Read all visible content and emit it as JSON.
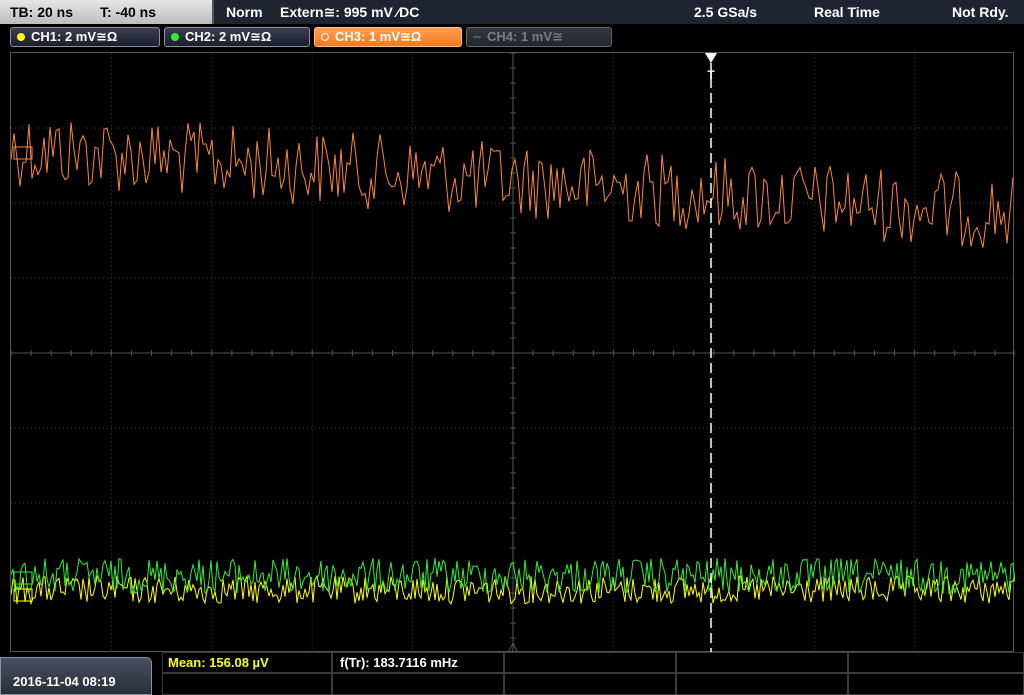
{
  "topbar": {
    "timebase": "TB: 20 ns",
    "trigger_time": "T: -40 ns",
    "trigger_mode": "Norm",
    "trigger_source": "Extern≅: 995 mV ∕DC",
    "sample_rate": "2.5 GSa/s",
    "acquisition": "Real Time",
    "status": "Not Rdy."
  },
  "channels": [
    {
      "label": "CH1: 2 mV≅Ω",
      "color": "#ffff00",
      "active": false
    },
    {
      "label": "CH2: 2 mV≅Ω",
      "color": "#33ee33",
      "active": false
    },
    {
      "label": "CH3: 1 mV≅Ω",
      "color": "#ff8833",
      "active": true
    },
    {
      "label": "CH4: 1 mV≅",
      "color": "#777777",
      "active": false
    }
  ],
  "screen": {
    "trigger_marker": "T"
  },
  "measurements": {
    "mean": "Mean: 156.08 µV",
    "freq": "f(Tr): 183.7116 mHz"
  },
  "datetime": "2016-11-04 08:19",
  "colors": {
    "ch1": "#ffff00",
    "ch2": "#33ee33",
    "ch3": "#ff8833",
    "grid": "#3a3a3a",
    "axis": "#555555",
    "trigger_line": "#ffffff"
  },
  "traces": {
    "ch3": {
      "noise_amplitude_mV": 1.0
    },
    "ch2": {
      "noise_amplitude_mV": 1.5
    },
    "ch1": {
      "noise_amplitude_mV": 1.0
    }
  }
}
